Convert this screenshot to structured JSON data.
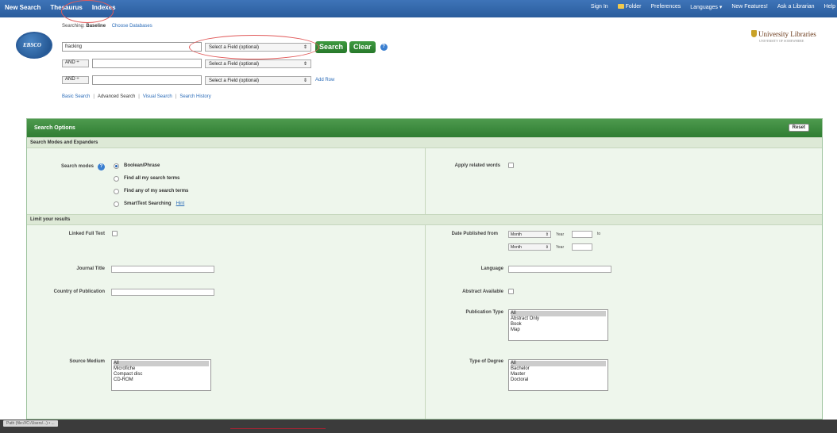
{
  "topbar": {
    "left_items": [
      "New Search",
      "Thesaurus",
      "Indexes"
    ],
    "right_items": [
      "Sign In",
      "Folder",
      "Preferences",
      "Languages ▾",
      "New Features!",
      "Ask a Librarian",
      "Help"
    ]
  },
  "logo": {
    "text": "EBSCO"
  },
  "searching": {
    "label": "Searching:",
    "database": "Baseline",
    "choose_link": "Choose Databases"
  },
  "rows": [
    {
      "bool": "",
      "term": "fracking",
      "field": "Select a Field (optional)"
    },
    {
      "bool": "AND ÷",
      "term": "",
      "field": "Select a Field (optional)"
    },
    {
      "bool": "AND ÷",
      "term": "",
      "field": "Select a Field (optional)"
    }
  ],
  "buttons": {
    "search": "Search",
    "clear": "Clear",
    "help": "?",
    "add_row": "Add Row"
  },
  "sublinks": [
    "Basic Search",
    "Advanced Search",
    "Visual Search",
    "Search History"
  ],
  "university": {
    "name": "University Libraries",
    "sub": "UNIVERSITY OF SOMEWHERE"
  },
  "options": {
    "header": "Search Options",
    "reset": "Reset",
    "section1": "Search Modes and Expanders",
    "search_modes_label": "Search modes",
    "modes": [
      "Boolean/Phrase",
      "Find all my search terms",
      "Find any of my search terms",
      "SmartText Searching"
    ],
    "hint": "Hint",
    "apply_related": "Apply related words",
    "section2": "Limit your results",
    "linked_full_text": "Linked Full Text",
    "journal_title": "Journal Title",
    "country": "Country of Publication",
    "date_published": "Date Published from",
    "month": "Month",
    "year": "Year",
    "to": "to",
    "language": "Language",
    "abstract_available": "Abstract Available",
    "publication_type": "Publication Type",
    "pub_types": [
      "All",
      "Abstract Only",
      "Book",
      "Map"
    ],
    "source_medium": "Source Medium",
    "source_types": [
      "All",
      "Microfiche",
      "Compact disc",
      "CD-ROM"
    ],
    "type_of_degree": "Type of Degree",
    "degree_types": [
      "All",
      "Bachelor",
      "Master",
      "Doctoral"
    ]
  },
  "status": {
    "text": "Path (file:///C:/Users/...) • ..."
  }
}
